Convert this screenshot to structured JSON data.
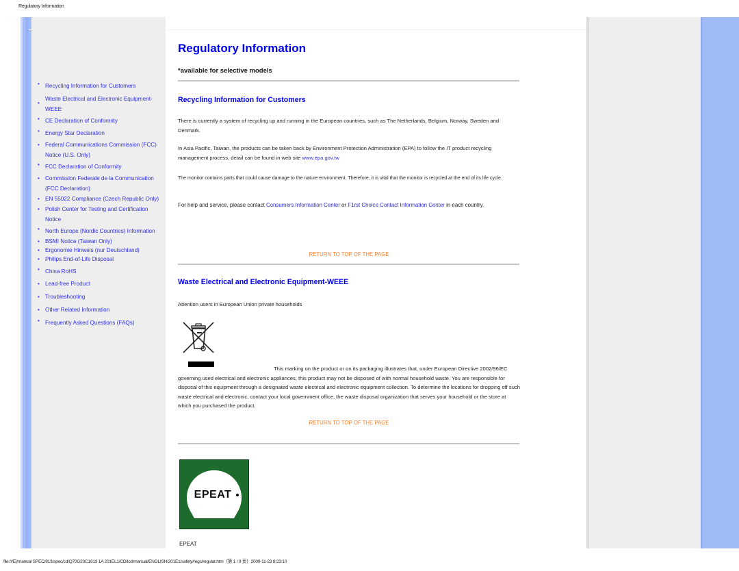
{
  "header": {
    "title": "Regulatory Information"
  },
  "sidebar": {
    "items": [
      {
        "label": "Recycling Information for Customers",
        "bullet": "raised"
      },
      {
        "label": "Waste Electrical and Electronic Equipment-WEEE",
        "bullet": "mid"
      },
      {
        "label": "CE Declaration of Conformity",
        "bullet": "raised"
      },
      {
        "label": "Energy Star Declaration",
        "bullet": "raised"
      },
      {
        "label": "Federal Communications Commission (FCC) Notice (U.S. Only)",
        "bullet": "normal"
      },
      {
        "label": "FCC Declaration of Conformity",
        "bullet": "raised"
      },
      {
        "label": "Commission Federale de la Communication (FCC Declaration)",
        "bullet": "normal"
      },
      {
        "label": "EN 55022 Compliance (Czech Republic Only)",
        "bullet": "normal"
      },
      {
        "label": "Polish Center for Testing and Certification Notice",
        "bullet": "normal"
      },
      {
        "label": "North Europe (Nordic Countries) Information",
        "bullet": "raised"
      },
      {
        "label": "BSMI Notice (Taiwan Only)",
        "bullet": "normal"
      },
      {
        "label": "Ergonomie Hinweis (nur Deutschland)",
        "bullet": "normal"
      },
      {
        "label": "Philips End-of-Life Disposal",
        "bullet": "normal"
      },
      {
        "label": "China RoHS",
        "bullet": "raised"
      },
      {
        "label": "Lead-free Product",
        "bullet": "normal"
      },
      {
        "label": "Troubleshooting",
        "bullet": "normal"
      },
      {
        "label": "Other Related Information",
        "bullet": "normal"
      },
      {
        "label": "Frequently Asked Questions (FAQs)",
        "bullet": "raised"
      }
    ]
  },
  "main": {
    "title": "Regulatory Information",
    "subtitle": "*available for selective models",
    "recycling": {
      "title": "Recycling Information for Customers",
      "p1": "There is currently a system of recycling up and running in the European countries, such as The Netherlands, Belgium, Norway, Sweden and Denmark.",
      "p2_before": "In Asia Pacific, Taiwan, the products can be taken back by Environment Protection Administration (EPA) to follow the IT product recycling management process, detail can be found in web site ",
      "p2_link": "www.epa.gov.tw",
      "p3": "The monitor contains parts that could cause damage to the nature environment. Therefore, it is vital that the monitor is recycled at the end of its life cycle.",
      "p4_before": "For help and service, please contact ",
      "p4_link1": "Consumers Information Center",
      "p4_mid": " or ",
      "p4_link2": "F1rst Choice Contact Information Center",
      "p4_after": " in each country."
    },
    "return_top_label": "RETURN TO TOP OF THE PAGE",
    "weee": {
      "title": "Waste Electrical and Electronic Equipment-WEEE",
      "attention": "Attention users in European Union private households",
      "marking_first": "This marking on the product or on its packaging illustrates that, under European Directive 2002/96/EC",
      "marking_rest": "governing used electrical and electronic appliances, this product may not be disposed of with normal household waste. You are responsible for disposal of this equipment through a designated waste electrical and electronic equipment collection. To determine the locations for dropping off such waste electrical and electronic, contact your local government office, the waste disposal organization that serves your household or the store at which you purchased the product."
    },
    "epeat": {
      "logo_text": "EPEAT",
      "caption": "EPEAT"
    }
  },
  "footer": {
    "path": "file:///E|/manual SPEC/813/spec/cd/Q70G20C1813 1A 201EL1/CD/lcd/manual/ENGLISH/201E1/safety/regs/regulat.htm（第 1 / 9 页）2009-11-23 8:23:10"
  },
  "colors": {
    "link": "#0000ee",
    "return_link": "#ff7f2a",
    "frame_bg": "#eeeeee",
    "frame_blue": "#9ebbf8",
    "epeat_green": "#1e6b2e"
  }
}
